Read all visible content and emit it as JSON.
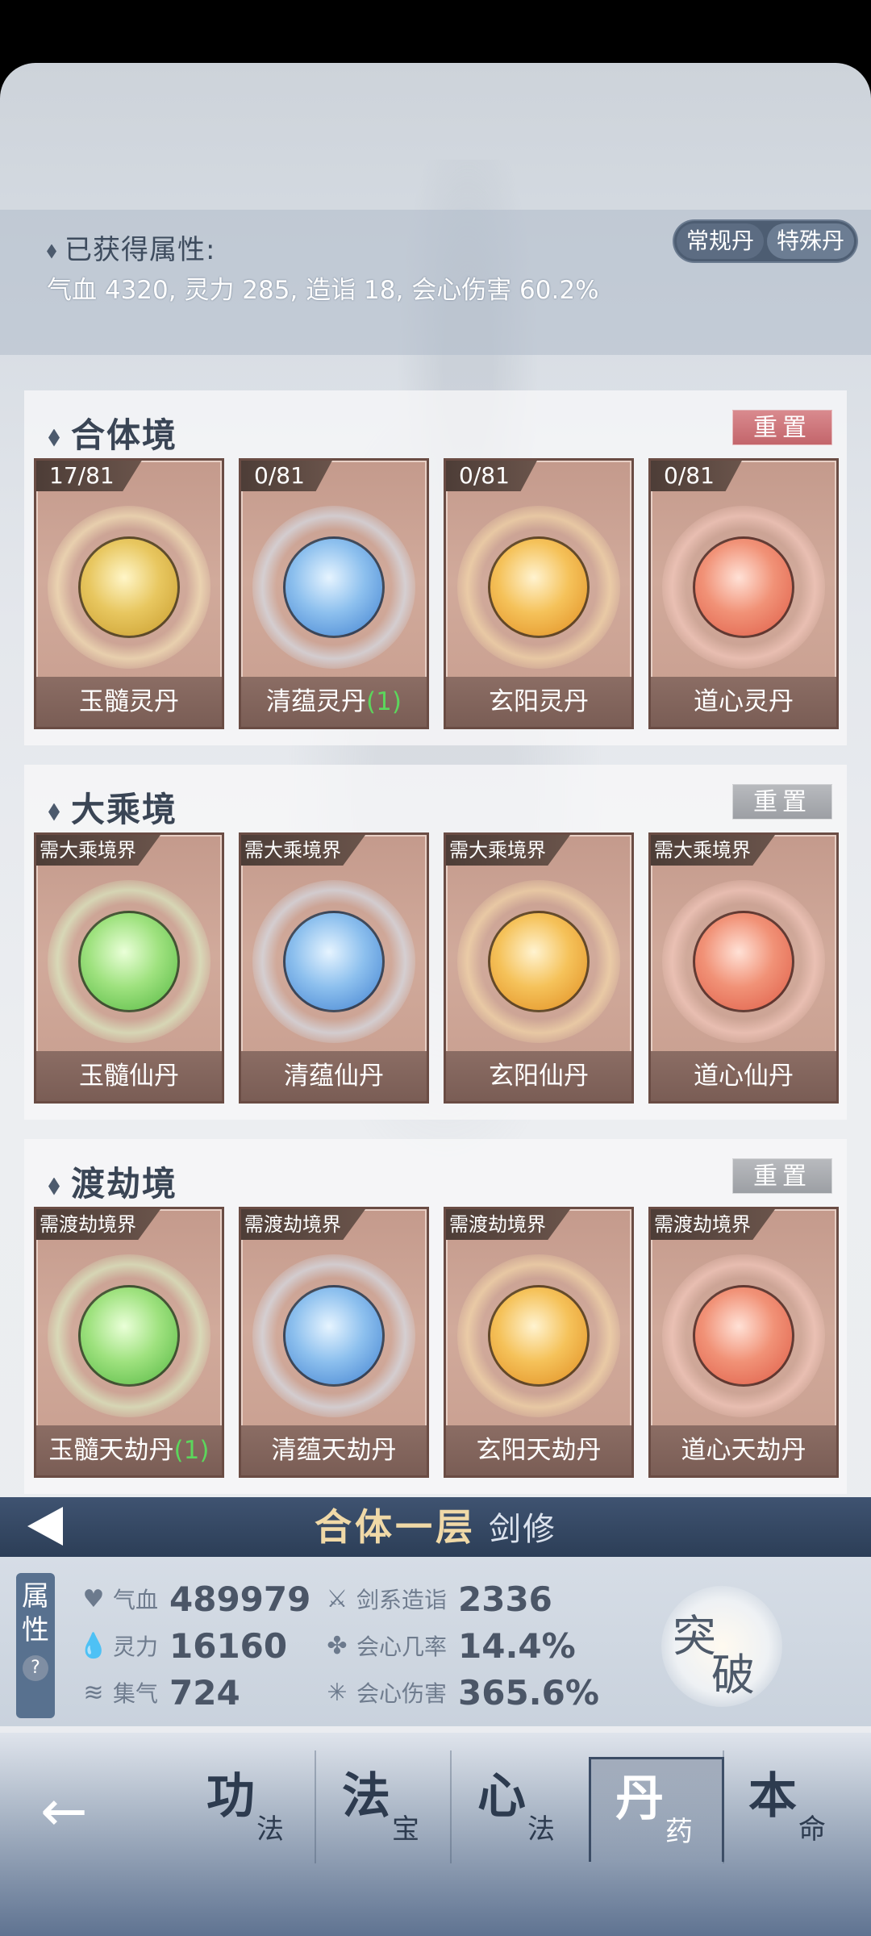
{
  "attributes_panel": {
    "title": "已获得属性:",
    "values": "气血 4320, 灵力 285, 造诣 18, 会心伤害 60.2%",
    "tabs": [
      {
        "label": "常规丹",
        "active": true
      },
      {
        "label": "特殊丹",
        "active": false
      }
    ]
  },
  "sections": [
    {
      "title": "合体境",
      "reset_label": "重置",
      "cards": [
        {
          "tag": "17/81",
          "name": "玉髓灵丹",
          "count": "",
          "color": "gold"
        },
        {
          "tag": "0/81",
          "name": "清蕴灵丹",
          "count": "(1)",
          "color": "blue"
        },
        {
          "tag": "0/81",
          "name": "玄阳灵丹",
          "count": "",
          "color": "orange"
        },
        {
          "tag": "0/81",
          "name": "道心灵丹",
          "count": "",
          "color": "red"
        }
      ]
    },
    {
      "title": "大乘境",
      "reset_label": "重置",
      "cards": [
        {
          "tag": "需大乘境界",
          "name": "玉髓仙丹",
          "count": "",
          "color": "green"
        },
        {
          "tag": "需大乘境界",
          "name": "清蕴仙丹",
          "count": "",
          "color": "blue"
        },
        {
          "tag": "需大乘境界",
          "name": "玄阳仙丹",
          "count": "",
          "color": "orange"
        },
        {
          "tag": "需大乘境界",
          "name": "道心仙丹",
          "count": "",
          "color": "red"
        }
      ]
    },
    {
      "title": "渡劫境",
      "reset_label": "重置",
      "cards": [
        {
          "tag": "需渡劫境界",
          "name": "玉髓天劫丹",
          "count": "(1)",
          "color": "green"
        },
        {
          "tag": "需渡劫境界",
          "name": "清蕴天劫丹",
          "count": "",
          "color": "blue"
        },
        {
          "tag": "需渡劫境界",
          "name": "玄阳天劫丹",
          "count": "",
          "color": "orange"
        },
        {
          "tag": "需渡劫境界",
          "name": "道心天劫丹",
          "count": "",
          "color": "red"
        }
      ]
    }
  ],
  "realm": {
    "name": "合体一层",
    "class": "剑修"
  },
  "stats_panel": {
    "side_label_1": "属",
    "side_label_2": "性",
    "help": "?",
    "stats": [
      {
        "label": "气血",
        "value": "489979",
        "icon": "heart-icon"
      },
      {
        "label": "剑系造诣",
        "value": "2336",
        "icon": "sword-icon"
      },
      {
        "label": "灵力",
        "value": "16160",
        "icon": "droplet-icon"
      },
      {
        "label": "会心几率",
        "value": "14.4%",
        "icon": "swirl-icon"
      },
      {
        "label": "集气",
        "value": "724",
        "icon": "wind-icon"
      },
      {
        "label": "会心伤害",
        "value": "365.6%",
        "icon": "burst-icon"
      }
    ],
    "breakthrough": {
      "top": "突",
      "bottom": "破"
    }
  },
  "bottom_nav": {
    "items": [
      {
        "big": "功",
        "small": "法"
      },
      {
        "big": "法",
        "small": "宝"
      },
      {
        "big": "心",
        "small": "法"
      },
      {
        "big": "丹",
        "small": "药",
        "active": true
      },
      {
        "big": "本",
        "small": "命"
      }
    ]
  },
  "colors": {
    "gold": "#e8c760",
    "blue": "#8dc0ee",
    "orange": "#f5c25a",
    "red": "#f19277",
    "green": "#9fe27f",
    "accent_text": "#f0d9a7"
  }
}
